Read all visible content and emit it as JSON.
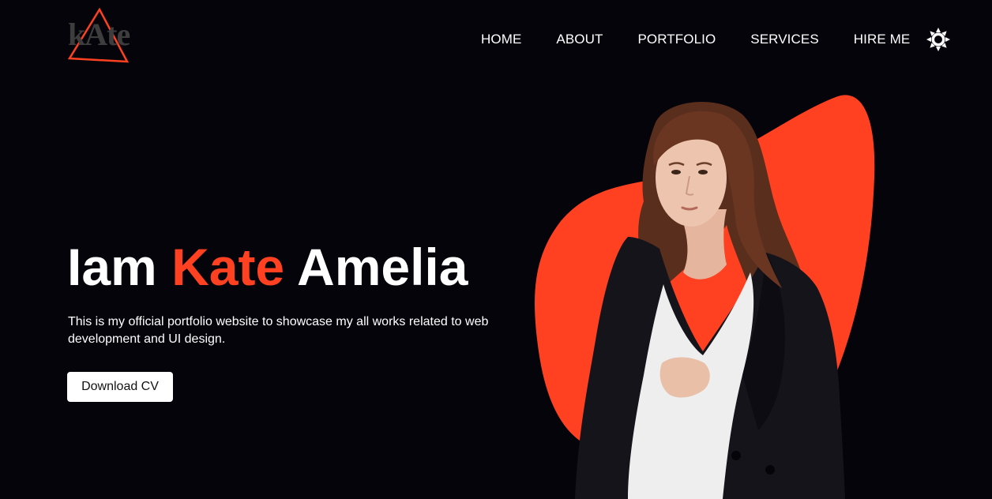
{
  "brand": {
    "logo_text": "kAte",
    "accent_color": "#ff4122"
  },
  "nav": {
    "items": [
      {
        "label": "HOME"
      },
      {
        "label": "ABOUT"
      },
      {
        "label": "PORTFOLIO"
      },
      {
        "label": "SERVICES"
      },
      {
        "label": "HIRE ME"
      }
    ],
    "theme_icon": "sun-icon"
  },
  "hero": {
    "title_prefix": "Iam",
    "title_highlight": "Kate",
    "title_suffix": "Amelia",
    "description": "This is my official portfolio website to showcase my all works related to web development and UI design.",
    "cta_label": "Download CV",
    "image_alt": "portrait photo"
  },
  "colors": {
    "background": "#05040a",
    "accent": "#ff4122",
    "text": "#ffffff"
  }
}
